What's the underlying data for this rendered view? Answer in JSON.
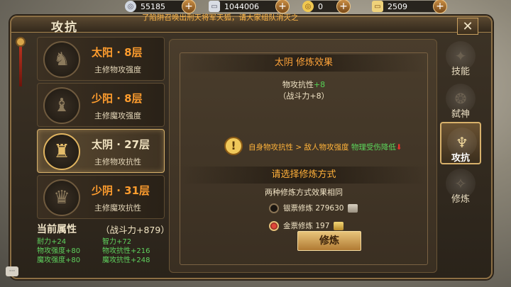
{
  "resources": [
    {
      "icon": "silver-coin-icon",
      "value": "55185"
    },
    {
      "icon": "silver-ticket-icon",
      "value": "1044006"
    },
    {
      "icon": "gold-coin-icon",
      "value": "0"
    },
    {
      "icon": "gold-ticket-icon",
      "value": "2509"
    }
  ],
  "ticker": "了陷阱召唤出刑天将军天狐，请大家组队消灭之",
  "window": {
    "title": "攻抗",
    "close_label": "✕"
  },
  "list": [
    {
      "name": "太阳 · 8层",
      "desc": "主修物攻强度",
      "selected": false
    },
    {
      "name": "少阳 · 8层",
      "desc": "主修魔攻强度",
      "selected": false
    },
    {
      "name": "太阴 · 27层",
      "desc": "主修物攻抗性",
      "selected": true
    },
    {
      "name": "少阴 · 31层",
      "desc": "主修魔攻抗性",
      "selected": false
    }
  ],
  "attributes": {
    "header": "当前属性",
    "combat_power": "（战斗力+879）",
    "rows": [
      [
        "耐力+24",
        "智力+72"
      ],
      [
        "物攻强度+80",
        "物攻抗性+216"
      ],
      [
        "魔攻强度+80",
        "魔攻抗性+248"
      ]
    ]
  },
  "effect": {
    "title": "太阴 修炼效果",
    "stat_label": "物攻抗性",
    "stat_value": "+8",
    "combat": "（战斗力+8）",
    "note_prefix": "自身物攻抗性 > 敌人物攻强度",
    "note_suffix": "物理受伤降低",
    "note_arrow": "⬇"
  },
  "method": {
    "title": "请选择修炼方式",
    "subtitle": "两种修炼方式效果相同",
    "options": [
      {
        "label": "银票修炼",
        "value": "279630",
        "selected": false
      },
      {
        "label": "金票修炼",
        "value": "197",
        "selected": true
      }
    ],
    "button": "修炼"
  },
  "tabs": [
    {
      "label": "技能",
      "active": false
    },
    {
      "label": "弑神",
      "active": false
    },
    {
      "label": "攻抗",
      "active": true
    },
    {
      "label": "修炼",
      "active": false
    }
  ],
  "chat_label": "···"
}
